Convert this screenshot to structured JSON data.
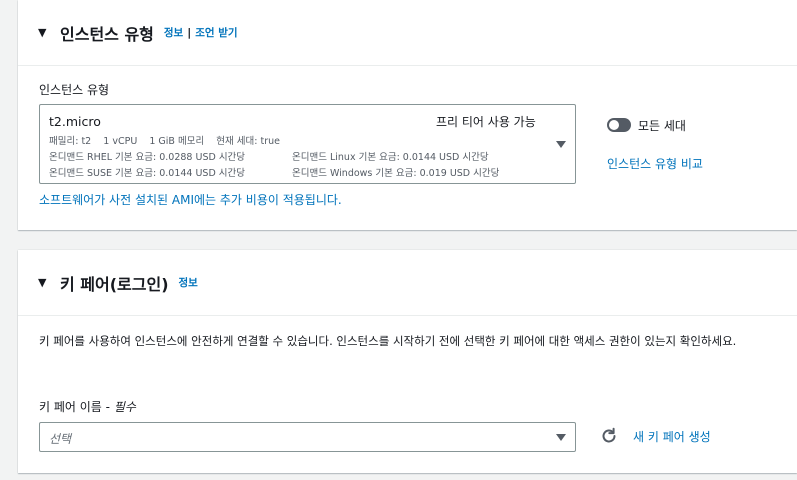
{
  "instance_type_panel": {
    "title": "인스턴스 유형",
    "info_link": "정보",
    "separator": "|",
    "advice_link": "조언 받기",
    "field_label": "인스턴스 유형",
    "selected": {
      "name": "t2.micro",
      "free_tier": "프리 티어 사용 가능",
      "meta_line1": "패밀리: t2    1 vCPU    1 GiB 메모리    현재 세대: true",
      "meta_line2a": "온디맨드 RHEL 기본 요금: 0.0288 USD 시간당",
      "meta_line2b": "온디맨드 Linux 기본 요금: 0.0144 USD 시간당",
      "meta_line3a": "온디맨드 SUSE 기본 요금: 0.0144 USD 시간당",
      "meta_line3b": "온디맨드 Windows 기본 요금: 0.019 USD 시간당"
    },
    "all_generations_label": "모든 세대",
    "all_generations_on": false,
    "compare_link": "인스턴스 유형 비교",
    "ami_note_link": "소프트웨어가 사전 설치된 AMI에는 추가 비용이 적용됩니다."
  },
  "key_pair_panel": {
    "title": "키 페어(로그인)",
    "info_link": "정보",
    "description": "키 페어를 사용하여 인스턴스에 안전하게 연결할 수 있습니다. 인스턴스를 시작하기 전에 선택한 키 페어에 대한 액세스 권한이 있는지 확인하세요.",
    "field_label": "키 페어 이름 -",
    "field_required": "필수",
    "select_placeholder": "선택",
    "create_link": "새 키 페어 생성"
  },
  "colors": {
    "link": "#0073bb",
    "background": "#f2f3f3",
    "border": "#879596"
  }
}
